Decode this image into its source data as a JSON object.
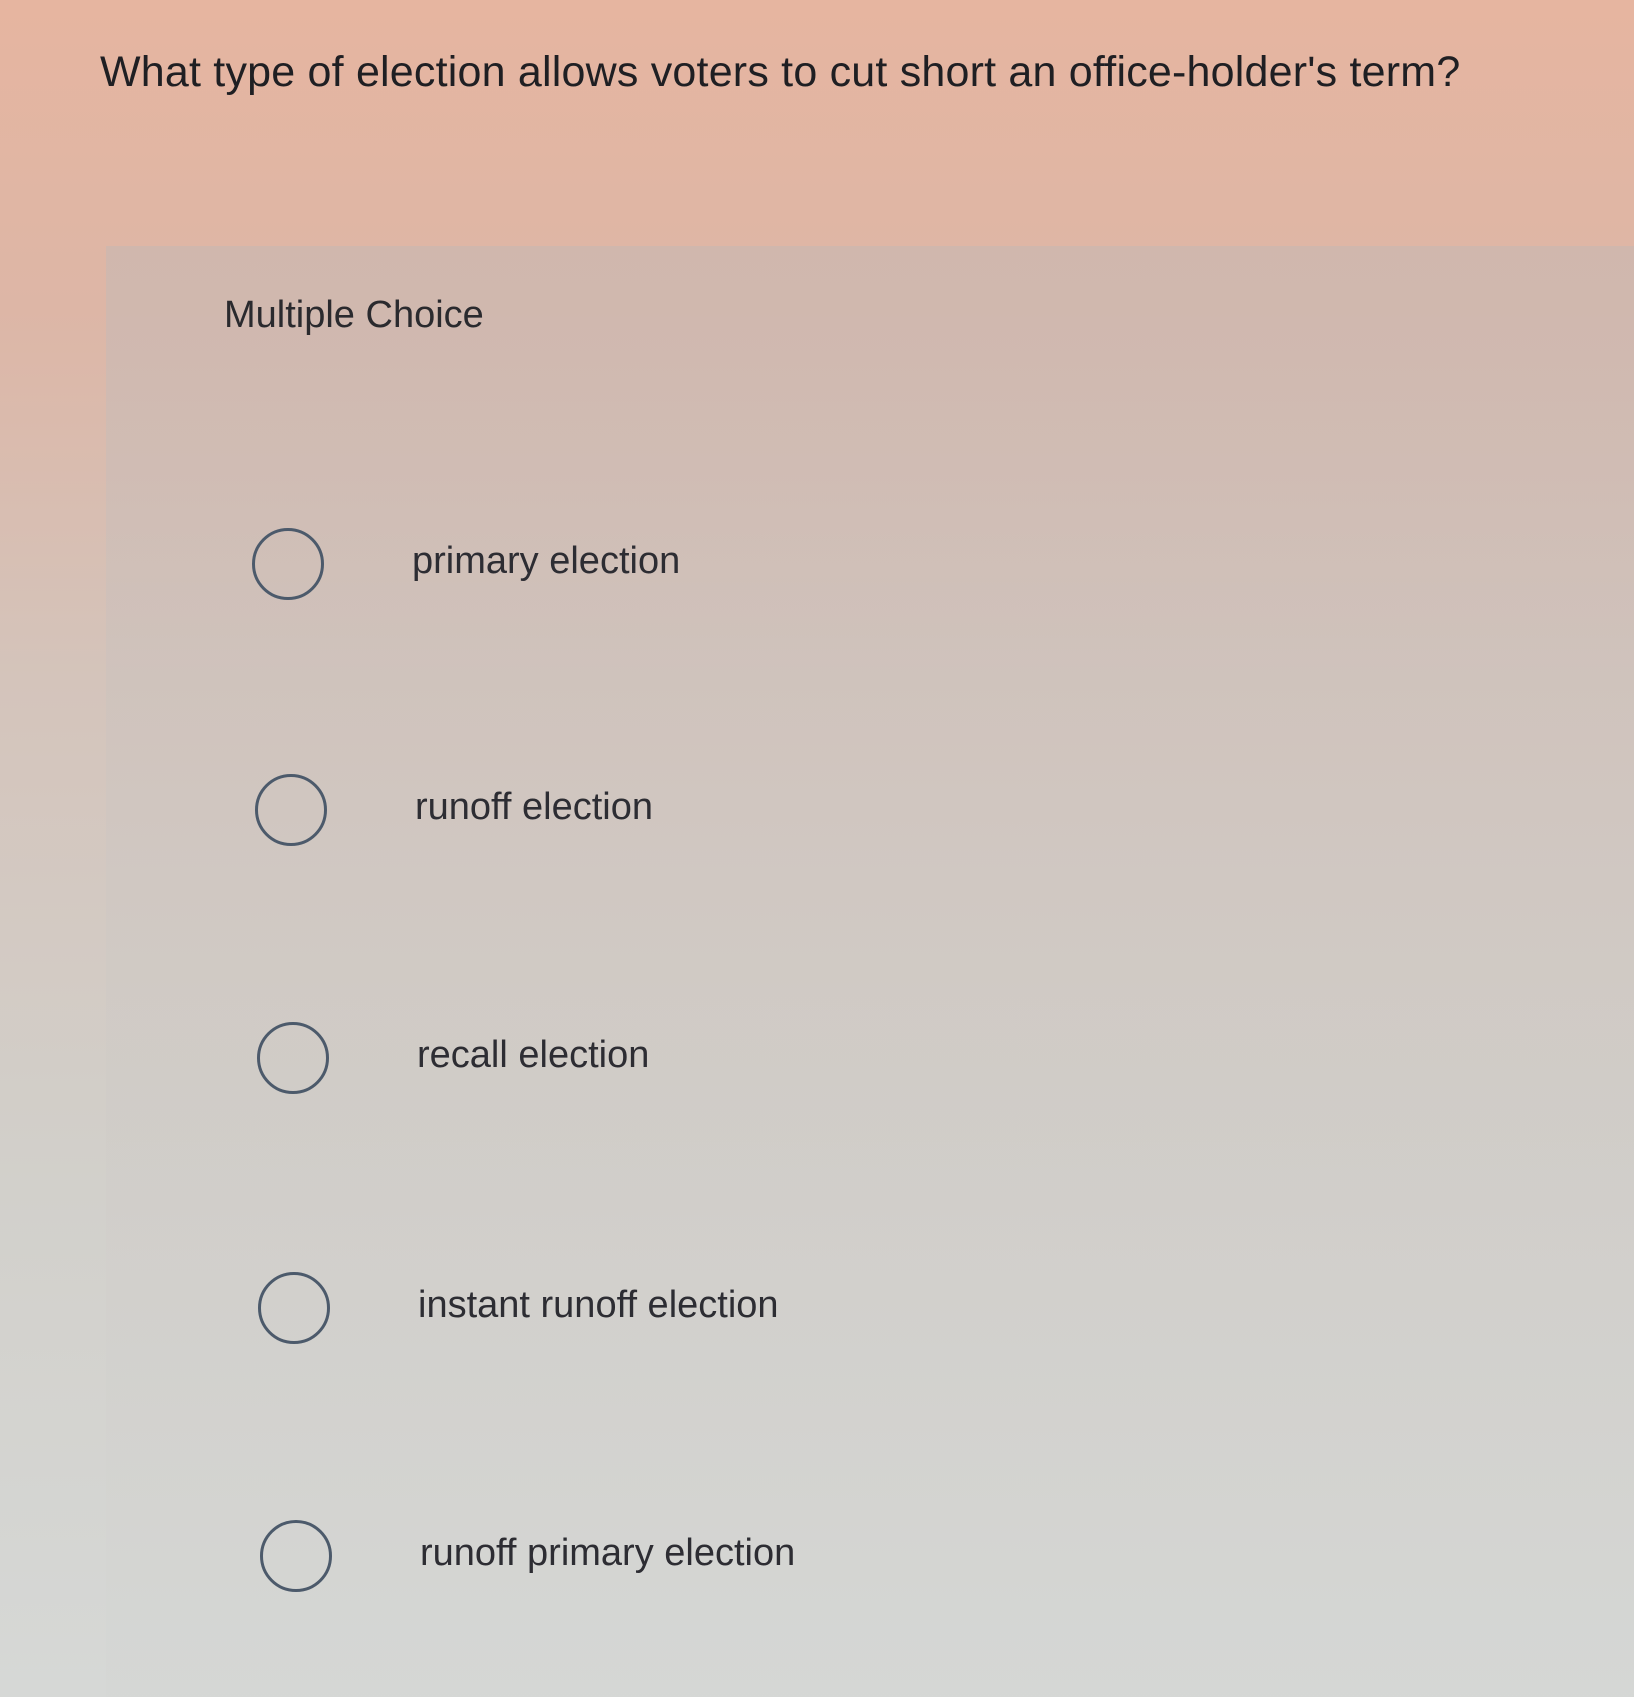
{
  "question": {
    "text": "What type of election allows voters to cut short an office-holder's term?"
  },
  "answer_panel": {
    "type_label": "Multiple Choice",
    "options": [
      {
        "label": "primary election",
        "selected": false
      },
      {
        "label": "runoff election",
        "selected": false
      },
      {
        "label": "recall election",
        "selected": false
      },
      {
        "label": "instant runoff election",
        "selected": false
      },
      {
        "label": "runoff primary election",
        "selected": false
      }
    ]
  },
  "colors": {
    "text": "#1f1f23",
    "radio_border": "#4c5a6b"
  }
}
